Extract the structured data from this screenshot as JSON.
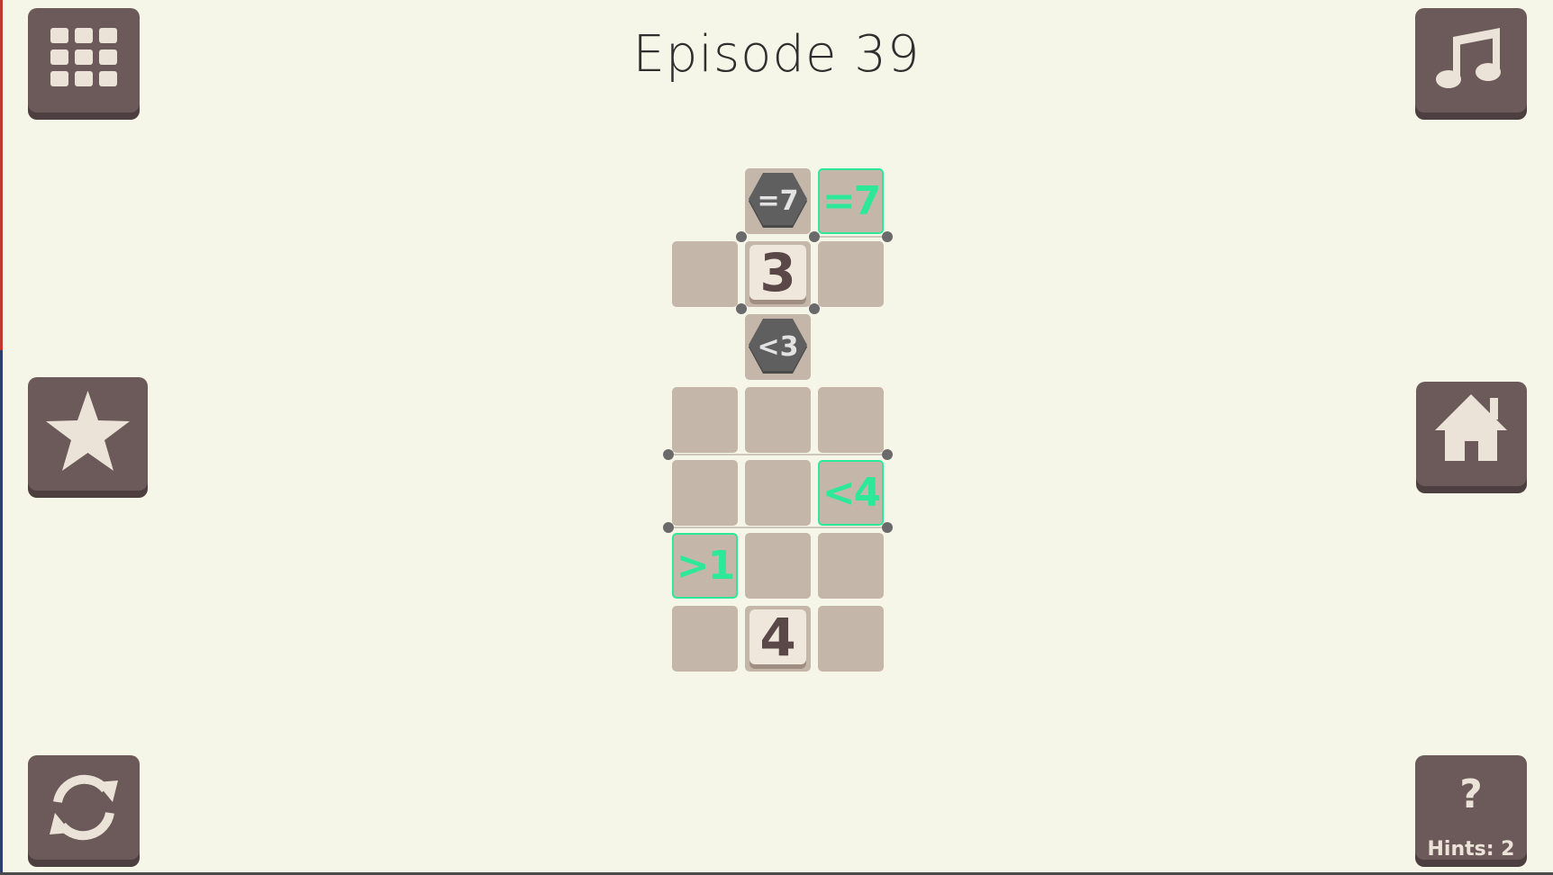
{
  "header": {
    "title_label": "Episode",
    "title_number": "39"
  },
  "buttons": {
    "menu": "grid-icon",
    "music": "music-note-icon",
    "star": "star-icon",
    "home": "home-icon",
    "restart": "restart-icon",
    "hint_symbol": "?",
    "hint_count_label": "Hints: 2"
  },
  "board": {
    "rows": 7,
    "cols": 3,
    "cells": [
      {
        "row": 0,
        "col": 1,
        "type": "constraint",
        "text": "=7"
      },
      {
        "row": 0,
        "col": 2,
        "type": "target",
        "text": "=7"
      },
      {
        "row": 1,
        "col": 0,
        "type": "empty"
      },
      {
        "row": 1,
        "col": 1,
        "type": "number",
        "text": "3"
      },
      {
        "row": 1,
        "col": 2,
        "type": "empty"
      },
      {
        "row": 2,
        "col": 1,
        "type": "constraint",
        "text": "<3"
      },
      {
        "row": 3,
        "col": 0,
        "type": "empty"
      },
      {
        "row": 3,
        "col": 1,
        "type": "empty"
      },
      {
        "row": 3,
        "col": 2,
        "type": "empty"
      },
      {
        "row": 4,
        "col": 0,
        "type": "empty"
      },
      {
        "row": 4,
        "col": 1,
        "type": "empty"
      },
      {
        "row": 4,
        "col": 2,
        "type": "target",
        "text": "<4"
      },
      {
        "row": 5,
        "col": 0,
        "type": "target",
        "text": ">1"
      },
      {
        "row": 5,
        "col": 1,
        "type": "empty"
      },
      {
        "row": 5,
        "col": 2,
        "type": "empty"
      },
      {
        "row": 6,
        "col": 0,
        "type": "empty"
      },
      {
        "row": 6,
        "col": 1,
        "type": "number",
        "text": "4"
      },
      {
        "row": 6,
        "col": 2,
        "type": "empty"
      }
    ]
  },
  "colors": {
    "background": "#f6f6e8",
    "button": "#6c5a5a",
    "cell": "#c4b7aa",
    "target_accent": "#2ee89a",
    "constraint_hex": "#5f5f5f"
  }
}
